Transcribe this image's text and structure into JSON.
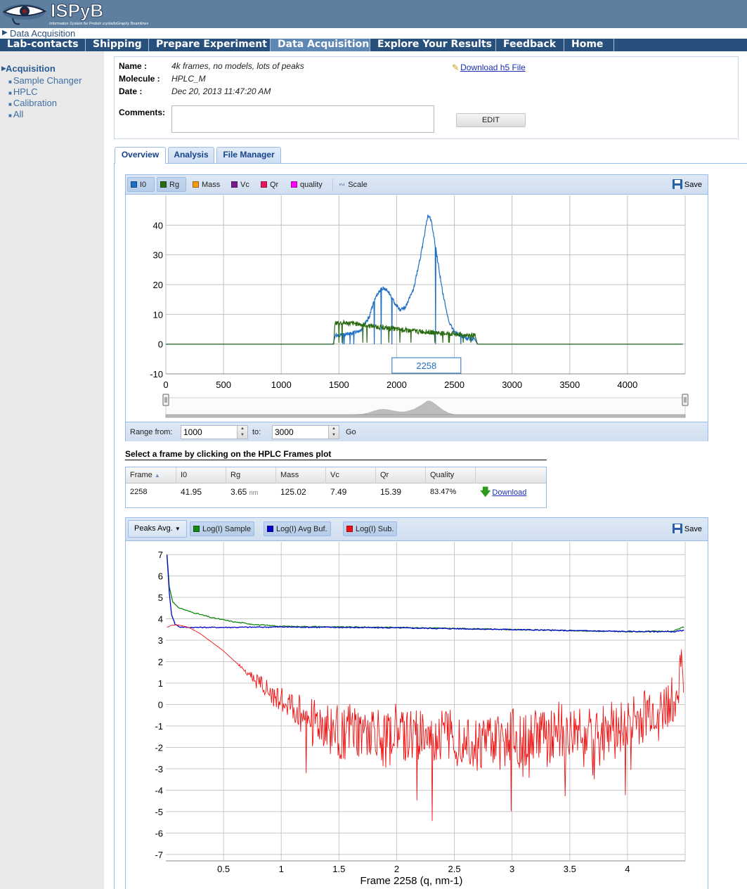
{
  "header": {
    "logo_text": "ISPyB",
    "logo_subtitle": "Information System for Protein crystalloGraphy Beamlines"
  },
  "breadcrumb": {
    "label": "Data Acquisition"
  },
  "nav": {
    "items": [
      {
        "label": "Lab-contacts"
      },
      {
        "label": "Shipping"
      },
      {
        "label": "Prepare Experiment"
      },
      {
        "label": "Data Acquisition"
      },
      {
        "label": "Explore Your Results"
      },
      {
        "label": "Feedback"
      },
      {
        "label": "Home"
      }
    ]
  },
  "sidebar": {
    "heading": "Acquisition",
    "items": [
      {
        "label": "Sample Changer"
      },
      {
        "label": "HPLC"
      },
      {
        "label": "Calibration"
      },
      {
        "label": "All"
      }
    ]
  },
  "info": {
    "name_label": "Name :",
    "name_value": "4k frames, no models, lots of peaks",
    "molecule_label": "Molecule :",
    "molecule_value": "HPLC_M",
    "date_label": "Date :",
    "date_value": "Dec 20, 2013 11:47:20 AM",
    "comments_label": "Comments:",
    "comments_value": "",
    "edit_label": "EDIT",
    "download_label": "Download h5 File"
  },
  "tabs": [
    {
      "label": "Overview"
    },
    {
      "label": "Analysis"
    },
    {
      "label": "File Manager"
    }
  ],
  "chart1_toolbar": {
    "series_buttons": [
      {
        "label": "I0",
        "color": "#1f6fc6",
        "pressed": true
      },
      {
        "label": "Rg",
        "color": "#2a6b12",
        "pressed": true
      },
      {
        "label": "Mass",
        "color": "#f39c12",
        "pressed": false
      },
      {
        "label": "Vc",
        "color": "#7b1a8c",
        "pressed": false
      },
      {
        "label": "Qr",
        "color": "#e8175d",
        "pressed": false
      },
      {
        "label": "quality",
        "color": "#ff00ff",
        "pressed": false
      }
    ],
    "scale_label": "Scale",
    "save_label": "Save"
  },
  "range": {
    "from_label": "Range from:",
    "from_value": "1000",
    "to_label": "to:",
    "to_value": "3000",
    "go_label": "Go"
  },
  "frames_grid": {
    "title": "Select a frame by clicking on the HPLC Frames plot",
    "columns": [
      "Frame",
      "I0",
      "Rg",
      "Mass",
      "Vc",
      "Qr",
      "Quality"
    ],
    "row": {
      "frame": "2258",
      "i0": "41.95",
      "rg": "3.65",
      "rg_unit": "nm",
      "mass": "125.02",
      "vc": "7.49",
      "qr": "15.39",
      "quality": "83.47%"
    },
    "download_label": "Download"
  },
  "chart2_toolbar": {
    "peaks_label": "Peaks Avg.",
    "series_buttons": [
      {
        "label": "Log(I) Sample",
        "color": "#118811"
      },
      {
        "label": "Log(I) Avg Buf.",
        "color": "#0000cc"
      },
      {
        "label": "Log(I) Sub.",
        "color": "#ee1111"
      }
    ],
    "save_label": "Save"
  },
  "chart_data": [
    {
      "type": "line",
      "xlim": [
        0,
        4500
      ],
      "ylim": [
        -10,
        50
      ],
      "x_ticks": [
        0,
        500,
        1000,
        1500,
        2000,
        2500,
        3000,
        3500,
        4000
      ],
      "y_ticks": [
        -10,
        0,
        10,
        20,
        30,
        40
      ],
      "selected_frame": "2258",
      "grid": true,
      "series": [
        {
          "name": "I0",
          "color": "#1f6fc6",
          "points": [
            [
              0,
              0
            ],
            [
              1450,
              0
            ],
            [
              1470,
              3
            ],
            [
              1500,
              3
            ],
            [
              1600,
              3.5
            ],
            [
              1700,
              5
            ],
            [
              1760,
              9
            ],
            [
              1800,
              14
            ],
            [
              1850,
              18
            ],
            [
              1890,
              19
            ],
            [
              1930,
              17.5
            ],
            [
              1980,
              14
            ],
            [
              2030,
              11.5
            ],
            [
              2080,
              12.5
            ],
            [
              2150,
              19
            ],
            [
              2220,
              32
            ],
            [
              2270,
              43.5
            ],
            [
              2300,
              41.5
            ],
            [
              2340,
              32
            ],
            [
              2400,
              17
            ],
            [
              2450,
              8
            ],
            [
              2500,
              4
            ],
            [
              2600,
              2
            ],
            [
              2680,
              1.5
            ],
            [
              2700,
              0
            ],
            [
              4500,
              0
            ]
          ]
        },
        {
          "name": "Rg",
          "color": "#2a6b12",
          "points": [
            [
              0,
              0
            ],
            [
              1455,
              0
            ],
            [
              1465,
              7
            ],
            [
              1500,
              7.2
            ],
            [
              1600,
              7
            ],
            [
              1700,
              6.6
            ],
            [
              1800,
              6
            ],
            [
              1900,
              5.5
            ],
            [
              2000,
              5
            ],
            [
              2100,
              4.6
            ],
            [
              2200,
              4.3
            ],
            [
              2300,
              4
            ],
            [
              2400,
              3.7
            ],
            [
              2500,
              3.4
            ],
            [
              2600,
              3.1
            ],
            [
              2680,
              2.8
            ],
            [
              2700,
              0
            ],
            [
              4500,
              0
            ]
          ]
        }
      ],
      "navigator": {
        "range": [
          1470,
          2700
        ]
      }
    },
    {
      "type": "line",
      "xlim": [
        0,
        4.5
      ],
      "ylim": [
        -7.3,
        7.2
      ],
      "x_ticks": [
        0.5,
        1,
        1.5,
        2,
        2.5,
        3,
        3.5,
        4
      ],
      "y_ticks": [
        -7,
        -6,
        -5,
        -4,
        -3,
        -2,
        -1,
        0,
        1,
        2,
        3,
        4,
        5,
        6,
        7
      ],
      "xlabel": "Frame 2258 (q, nm-1)",
      "grid": true,
      "series": [
        {
          "name": "Log(I) Sample",
          "color": "#118811",
          "points": [
            [
              0.01,
              7
            ],
            [
              0.03,
              5.5
            ],
            [
              0.06,
              4.8
            ],
            [
              0.1,
              4.55
            ],
            [
              0.2,
              4.35
            ],
            [
              0.3,
              4.2
            ],
            [
              0.4,
              4.05
            ],
            [
              0.5,
              3.95
            ],
            [
              0.6,
              3.85
            ],
            [
              0.8,
              3.72
            ],
            [
              1,
              3.65
            ],
            [
              1.5,
              3.62
            ],
            [
              2,
              3.6
            ],
            [
              2.5,
              3.55
            ],
            [
              3,
              3.5
            ],
            [
              3.5,
              3.45
            ],
            [
              4,
              3.4
            ],
            [
              4.4,
              3.42
            ],
            [
              4.48,
              3.6
            ]
          ]
        },
        {
          "name": "Log(I) Avg Buf.",
          "color": "#0000cc",
          "points": [
            [
              0.01,
              7
            ],
            [
              0.03,
              5.2
            ],
            [
              0.05,
              4.2
            ],
            [
              0.08,
              3.75
            ],
            [
              0.12,
              3.62
            ],
            [
              0.2,
              3.6
            ],
            [
              0.5,
              3.6
            ],
            [
              1,
              3.62
            ],
            [
              1.5,
              3.6
            ],
            [
              2,
              3.58
            ],
            [
              2.5,
              3.54
            ],
            [
              3,
              3.5
            ],
            [
              3.5,
              3.45
            ],
            [
              4,
              3.41
            ],
            [
              4.4,
              3.4
            ],
            [
              4.48,
              3.45
            ]
          ]
        },
        {
          "name": "Log(I) Sub.",
          "color": "#ee1111",
          "points": [
            [
              0.01,
              3.6
            ],
            [
              0.05,
              3.7
            ],
            [
              0.1,
              3.72
            ],
            [
              0.2,
              3.6
            ],
            [
              0.3,
              3.3
            ],
            [
              0.4,
              2.9
            ],
            [
              0.5,
              2.5
            ],
            [
              0.6,
              2.0
            ],
            [
              0.7,
              1.55
            ],
            [
              0.8,
              1.15
            ],
            [
              0.9,
              0.55
            ],
            [
              1.0,
              0.2
            ],
            [
              1.1,
              -0.2
            ],
            [
              1.2,
              -0.55
            ],
            [
              1.3,
              -0.8
            ],
            [
              1.4,
              -1.1
            ],
            [
              1.5,
              -1.35
            ],
            [
              1.6,
              -1.2
            ],
            [
              1.7,
              -1.5
            ],
            [
              1.8,
              -1.2
            ],
            [
              1.9,
              -1.7
            ],
            [
              2.0,
              -1.2
            ],
            [
              2.1,
              -1.6
            ],
            [
              2.2,
              -1.3
            ],
            [
              2.3,
              -1.8
            ],
            [
              2.4,
              -1.2
            ],
            [
              2.5,
              -1.7
            ],
            [
              2.6,
              -1.3
            ],
            [
              2.7,
              -2.0
            ],
            [
              2.8,
              -1.4
            ],
            [
              2.9,
              -1.8
            ],
            [
              3.0,
              -1.3
            ],
            [
              3.1,
              -1.9
            ],
            [
              3.2,
              -1.2
            ],
            [
              3.3,
              -1.7
            ],
            [
              3.4,
              -1.1
            ],
            [
              3.5,
              -1.6
            ],
            [
              3.6,
              -1.0
            ],
            [
              3.7,
              -1.4
            ],
            [
              3.8,
              -0.8
            ],
            [
              3.9,
              -1.3
            ],
            [
              4.0,
              -0.6
            ],
            [
              4.1,
              -0.9
            ],
            [
              4.2,
              -0.3
            ],
            [
              4.3,
              -0.5
            ],
            [
              4.4,
              0.4
            ],
            [
              4.48,
              1.8
            ]
          ]
        }
      ]
    }
  ]
}
